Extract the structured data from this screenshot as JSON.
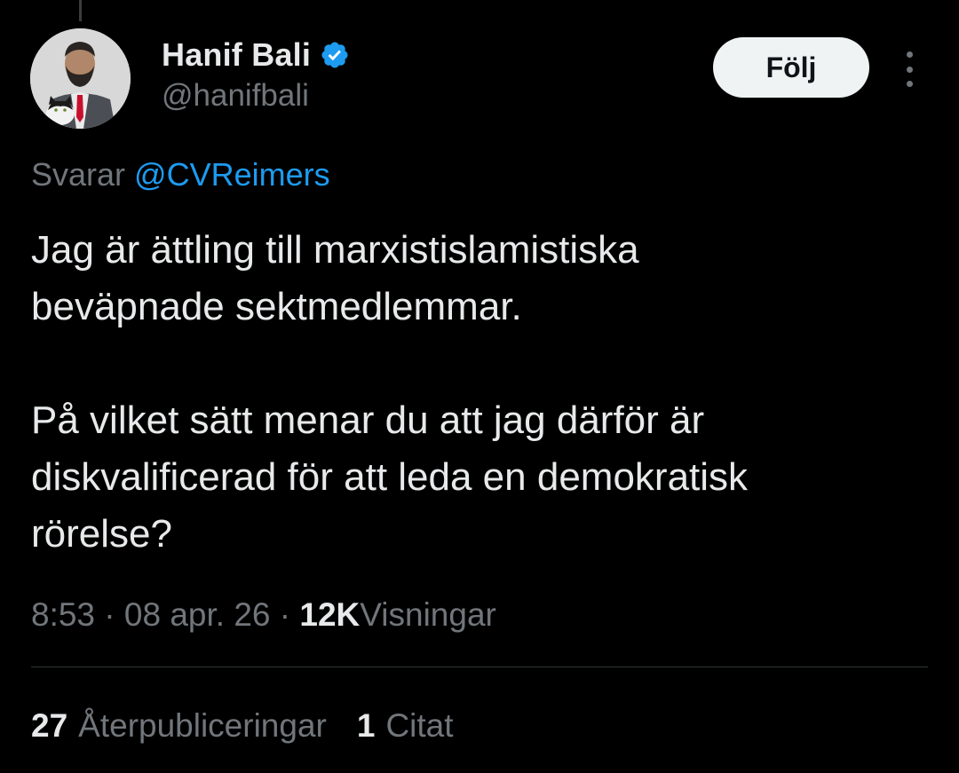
{
  "author": {
    "display_name": "Hanif Bali",
    "handle": "@hanifbali",
    "verified_icon": "verified-badge-icon",
    "avatar_icon": "profile-photo"
  },
  "actions": {
    "follow_label": "Följ",
    "more_icon": "more-options-icon"
  },
  "reply": {
    "prefix": "Svarar",
    "mention": "@CVReimers"
  },
  "tweet": {
    "paragraphs": [
      "Jag är ättling till marxistislamistiska\nbeväpnade sektmedlemmar.",
      "På vilket sätt menar du att jag därför är\ndiskvalificerad för att leda en demokratisk\nrörelse?"
    ]
  },
  "meta": {
    "time": "8:53",
    "separator": "·",
    "date": "08 apr. 26",
    "views_count": "12K",
    "views_label": "Visningar"
  },
  "stats": [
    {
      "count": "27",
      "label": "Återpubliceringar"
    },
    {
      "count": "1",
      "label": "Citat"
    }
  ],
  "colors": {
    "background": "#000000",
    "text_primary": "#e7e9ea",
    "text_secondary": "#71767b",
    "link": "#1d9bf0",
    "follow_bg": "#eff3f4",
    "divider": "#2f3336"
  }
}
